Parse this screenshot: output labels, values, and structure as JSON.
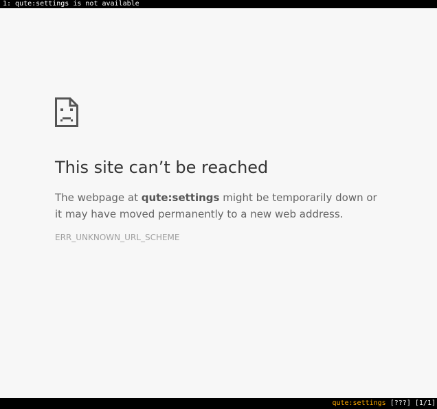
{
  "tabbar": {
    "tabs": [
      {
        "label": "1: qute:settings is not available"
      }
    ]
  },
  "error": {
    "icon": "sad-page-icon",
    "title": "This site can’t be reached",
    "description_prefix": "The webpage at ",
    "url": "qute:settings",
    "description_suffix": " might be temporarily down or it may have moved permanently to a new web address.",
    "code": "ERR_UNKNOWN_URL_SCHEME"
  },
  "statusbar": {
    "url": "qute:settings",
    "history": "[???]",
    "tab_index": "[1/1]",
    "url_color": "#ffaa00"
  }
}
